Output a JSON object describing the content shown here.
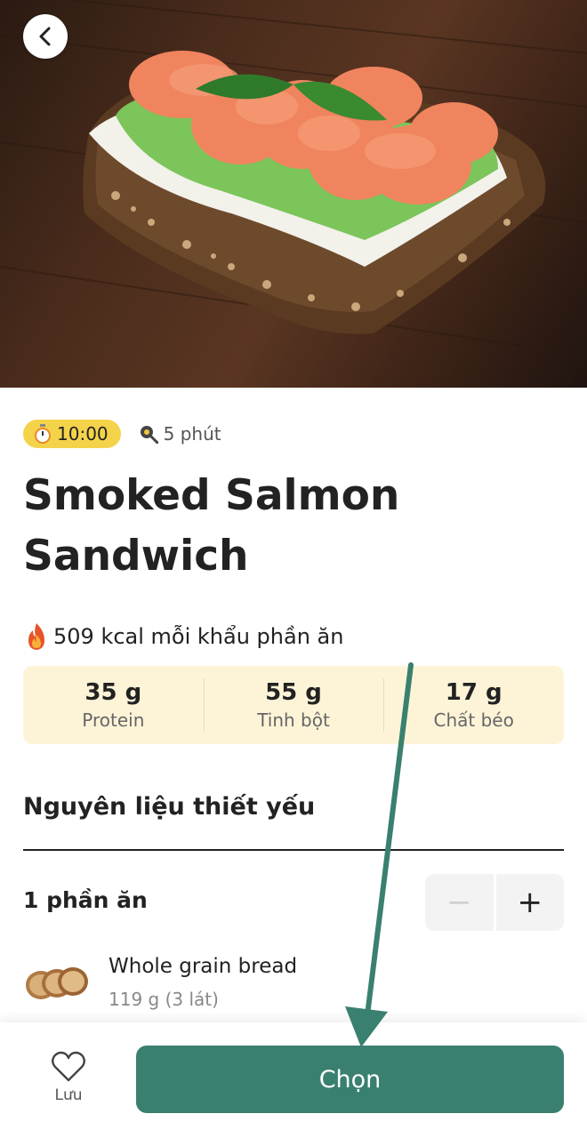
{
  "hero": {
    "image_description_icon": "smoked-salmon-sandwich-photo",
    "back_icon": "chevron-left-icon"
  },
  "meta": {
    "timer_icon": "stopwatch-icon",
    "time": "10:00",
    "prep_icon": "frying-pan-icon",
    "prep_time": "5 phút"
  },
  "recipe": {
    "title_line1": "Smoked Salmon",
    "title_line2": "Sandwich",
    "kcal_icon": "fire-icon",
    "kcal_text": "509 kcal mỗi khẩu phần ăn"
  },
  "macros": [
    {
      "value": "35 g",
      "label": "Protein"
    },
    {
      "value": "55 g",
      "label": "Tinh bột"
    },
    {
      "value": "17 g",
      "label": "Chất béo"
    }
  ],
  "ingredients_section": {
    "title": "Nguyên liệu thiết yếu",
    "servings": "1 phần ăn",
    "minus": "−",
    "plus": "+",
    "items": [
      {
        "name": "Whole grain bread",
        "amount": "119 g (3 lát)",
        "icon": "bread-slices-icon"
      }
    ]
  },
  "bottom": {
    "save_icon": "heart-outline-icon",
    "save_label": "Lưu",
    "choose_label": "Chọn"
  },
  "colors": {
    "accent": "#3a8070",
    "badge": "#f4d34a",
    "macro_bg": "#fdf4d8",
    "annotation_arrow": "#3a8070"
  }
}
